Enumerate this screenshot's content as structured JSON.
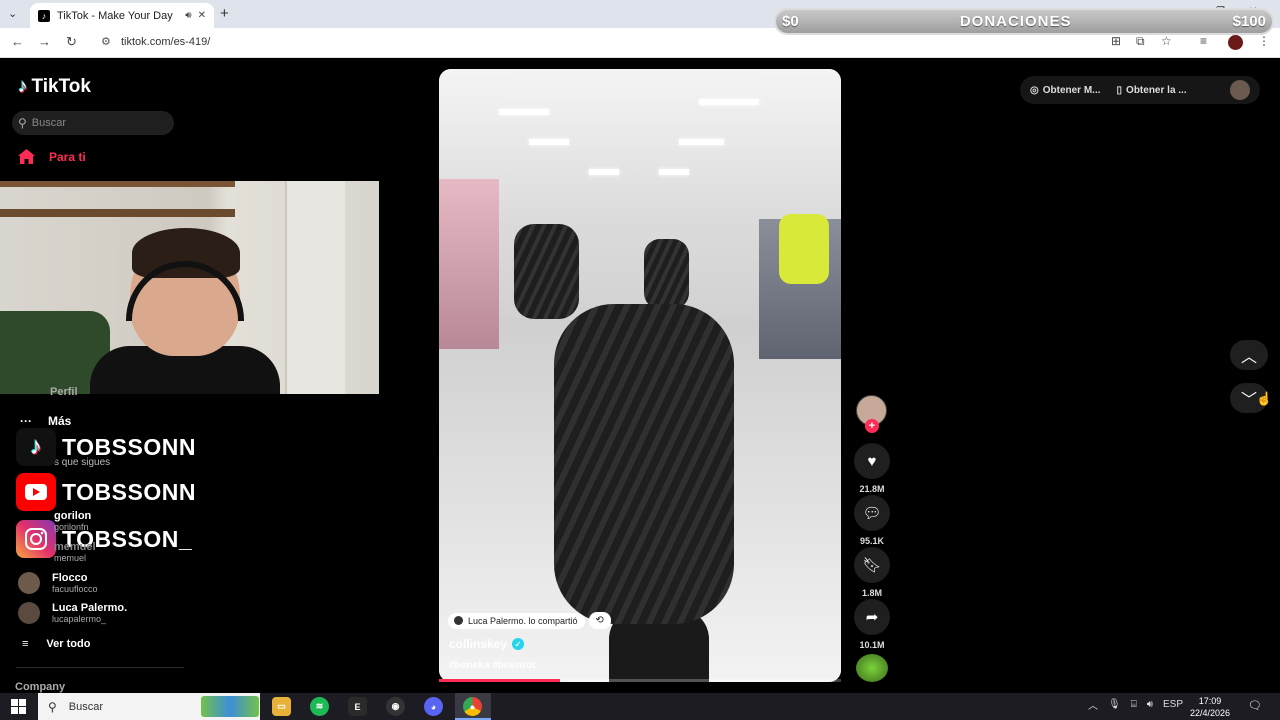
{
  "browser": {
    "tab_title": "TikTok - Make Your Day",
    "url": "tiktok.com/es-419/"
  },
  "donation_bar": {
    "left": "$0",
    "label": "DONACIONES",
    "right": "$100"
  },
  "tiktok": {
    "logo_text": "TikTok",
    "search_placeholder": "Buscar",
    "nav_for_you": "Para ti",
    "nav_profile_partial": "Perfil",
    "nav_more": "Más",
    "following_heading_partial": "s que sigues",
    "following": [
      {
        "name": "gorilon",
        "handle": "gorilonfn"
      },
      {
        "name": "memuel",
        "handle": "memuel"
      },
      {
        "name": "Flocco",
        "handle": "facuuflocco"
      },
      {
        "name": "Luca Palermo.",
        "handle": "lucapalermo_"
      }
    ],
    "see_all": "Ver todo",
    "company": "Company",
    "top_buttons": {
      "coins": "Obtener M...",
      "app": "Obtener la ..."
    }
  },
  "overlay_socials": [
    {
      "platform": "tiktok",
      "handle": "TOBSSONN",
      "color": "#111111"
    },
    {
      "platform": "youtube",
      "handle": "TOBSSONN",
      "color": "#ff0000"
    },
    {
      "platform": "instagram",
      "handle": "TOBSSON_",
      "color": "#c13584"
    }
  ],
  "video": {
    "shared_by": "Luca Palermo. lo compartió",
    "author": "collinskey",
    "hashtags": "#boneka #brainrot",
    "progress": 0.3
  },
  "actions": {
    "likes": "21.8M",
    "comments": "95.1K",
    "saves": "1.8M",
    "shares": "10.1M"
  },
  "taskbar": {
    "search_label": "Buscar",
    "language": "ESP",
    "time": "17:09",
    "date": "22/4/2026"
  },
  "colors": {
    "tiktok_red": "#fe2c55",
    "tiktok_cyan": "#25f4ee"
  }
}
